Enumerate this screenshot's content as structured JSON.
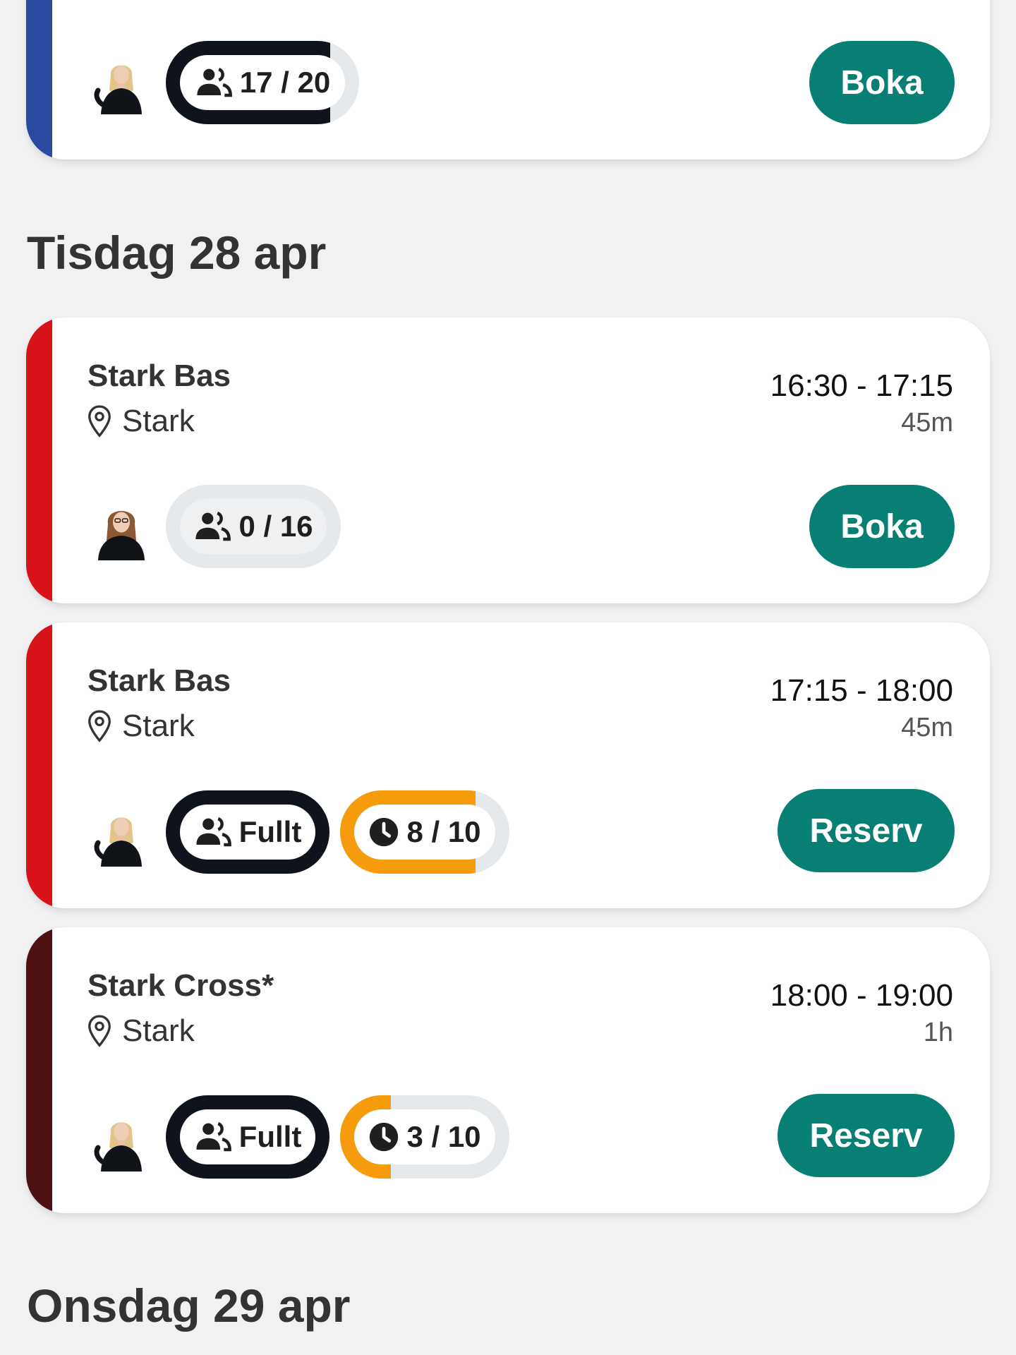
{
  "colors": {
    "background": "#f1f1f2",
    "button": "#087f73",
    "stripe_blue": "#2a4aa0",
    "stripe_red": "#d8131a",
    "stripe_maroon": "#4d1114",
    "occupancy_ring": "#0f141c",
    "waitlist_ring": "#f59b0c",
    "pill_track": "#e6e9eb"
  },
  "previous_card": {
    "occupancy": "17 / 20",
    "occupancy_fraction": 0.85,
    "button": "Boka",
    "avatar": "instructor-avatar-blonde"
  },
  "days": [
    {
      "heading": "Tisdag 28 apr"
    },
    {
      "heading": "Onsdag 29 apr"
    }
  ],
  "classes": [
    {
      "title": "Stark Bas",
      "location": "Stark",
      "time": "16:30 - 17:15",
      "duration": "45m",
      "occupancy": "0 / 16",
      "occupancy_fraction": 0.0,
      "button": "Boka",
      "avatar": "instructor-avatar-brunette"
    },
    {
      "title": "Stark Bas",
      "location": "Stark",
      "time": "17:15 - 18:00",
      "duration": "45m",
      "occupancy": "Fullt",
      "occupancy_fraction": 1.0,
      "waitlist": "8 / 10",
      "waitlist_fraction": 0.8,
      "button": "Reserv",
      "avatar": "instructor-avatar-blonde"
    },
    {
      "title": "Stark Cross*",
      "location": "Stark",
      "time": "18:00 - 19:00",
      "duration": "1h",
      "occupancy": "Fullt",
      "occupancy_fraction": 1.0,
      "waitlist": "3 / 10",
      "waitlist_fraction": 0.3,
      "button": "Reserv",
      "avatar": "instructor-avatar-blonde"
    }
  ]
}
